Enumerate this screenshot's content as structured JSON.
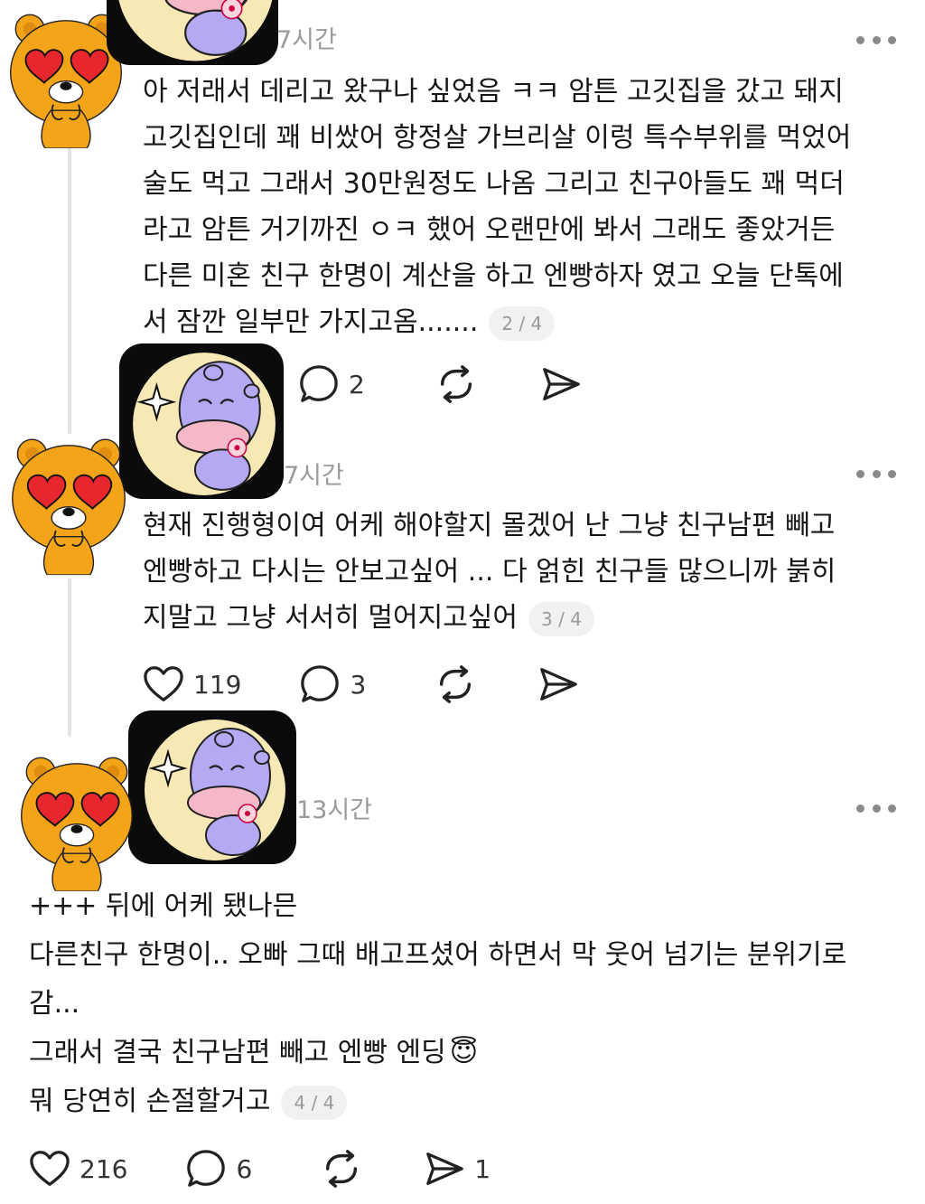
{
  "posts": [
    {
      "time": "7시간",
      "lines": [
        "아 저래서 데리고 왔구나 싶었음 ㅋㅋ 암튼 고깃집을 갔고 돼지",
        "고깃집인데 꽤 비쌌어 항정살 가브리살 이렁 특수부위를 먹었어",
        "술도 먹고 그래서 30만원정도 나옴 그리고 친구아들도 꽤 먹더",
        "라고 암튼 거기까진 ㅇㅋ 했어 오랜만에 봐서 그래도 좋았거든",
        "다른 미혼 친구 한명이 계산을 하고 엔빵하자 였고 오늘 단톡에",
        "서 잠깐 일부만 가지고옴......."
      ],
      "page": "2 / 4",
      "comments": "2"
    },
    {
      "time": "7시간",
      "lines": [
        "현재 진행형이여 어케 해야할지 몰겠어 난 그냥 친구남편 빼고",
        "엔빵하고 다시는 안보고싶어 ... 다 얽힌 친구들 많으니까 붉히",
        "지말고 그냥 서서히 멀어지고싶어"
      ],
      "page": "3 / 4",
      "likes": "119",
      "comments": "3"
    },
    {
      "time": "13시간",
      "lines": [
        "+++ 뒤에 어케 됐나믄",
        "다른친구 한명이.. 오빠 그때 배고프셨어 하면서 막 웃어 넘기는 분위기로",
        "감...",
        "그래서 결국 친구남편 빼고 엔빵 엔딩",
        "뭐 당연히 손절할거고"
      ],
      "emoji": "😇",
      "page": "4 / 4",
      "likes": "216",
      "comments": "6",
      "shares": "1"
    }
  ],
  "icons": {
    "more": "more-horizontal-icon",
    "like": "heart-icon",
    "comment": "comment-bubble-icon",
    "repost": "repost-icon",
    "share": "send-icon"
  },
  "colors": {
    "avatar_orange": "#F4A418",
    "heart_red": "#E8262D",
    "sticker_moon": "#F7E9B5",
    "sticker_hippo": "#B4A9F2",
    "timestamp": "#9A9A9A"
  }
}
